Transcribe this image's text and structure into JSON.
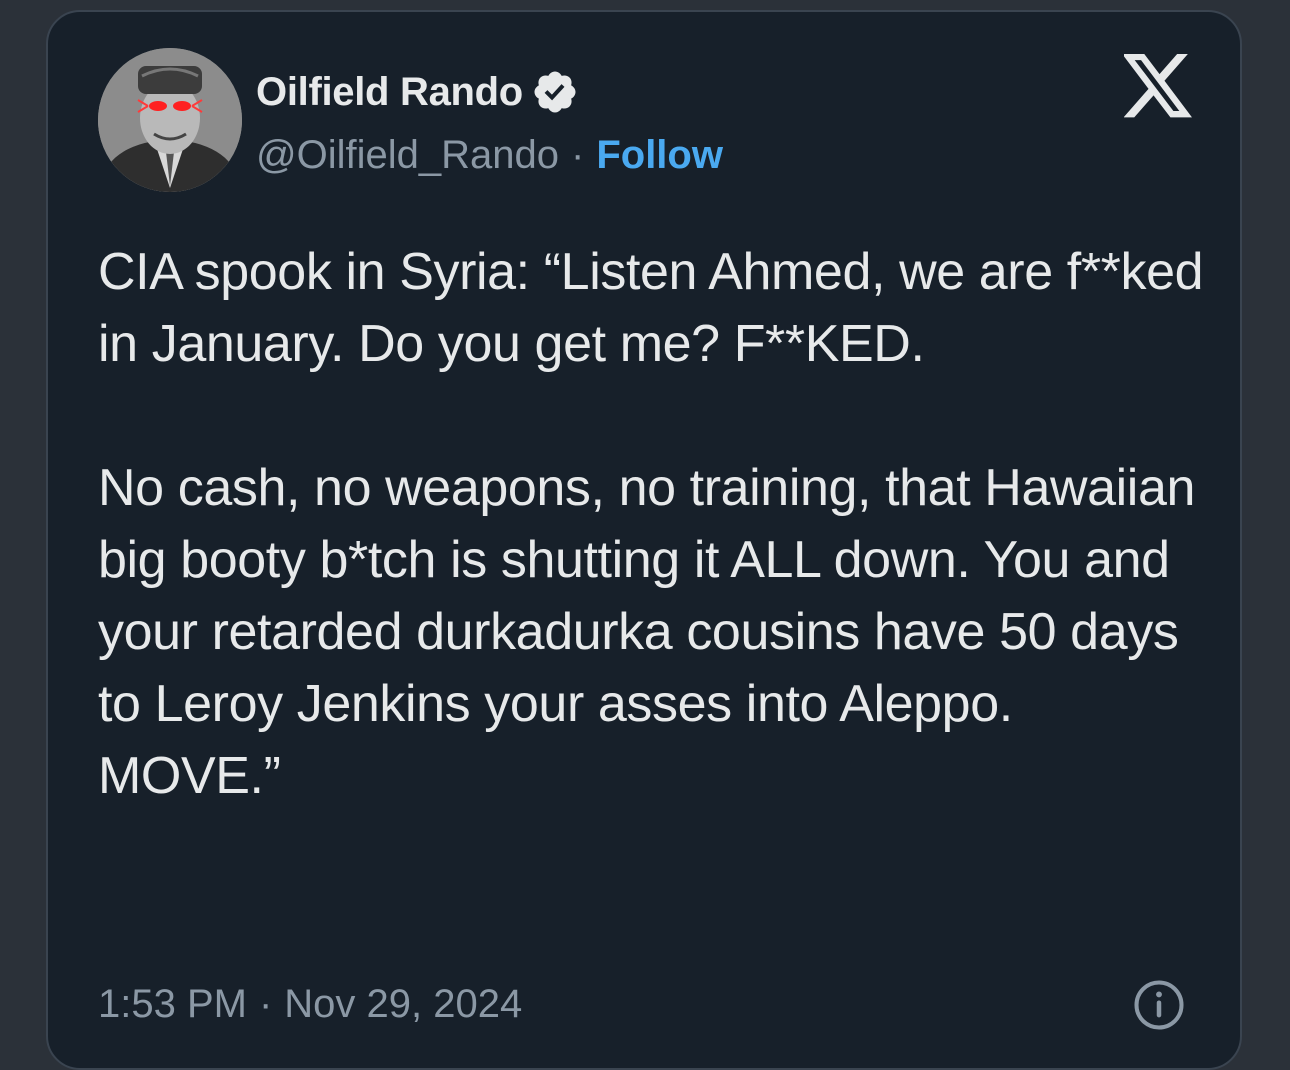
{
  "author": {
    "display_name": "Oilfield Rando",
    "handle": "@Oilfield_Rando",
    "separator": "·",
    "follow_label": "Follow",
    "verified": true,
    "avatar_icon": "avatar-laser-eyes-icon"
  },
  "tweet": {
    "paragraph_1": "CIA spook in Syria: “Listen Ahmed, we are f**ked in January. Do you get me? F**KED.",
    "paragraph_2": "No cash, no weapons, no training, that Hawaiian big booty b*tch is shutting it ALL down. You and your retarded durkadurka cousins have 50 days to Leroy Jenkins your asses into Aleppo. MOVE.”"
  },
  "meta": {
    "time": "1:53 PM",
    "separator": "·",
    "date": "Nov 29, 2024",
    "info_icon": "info-icon"
  },
  "brand": {
    "logo_icon": "x-logo-icon"
  },
  "colors": {
    "background": "#17202a",
    "text": "#e7e9ea",
    "muted": "#8b98a5",
    "link": "#4aa9f0",
    "verified_badge": "#e7e9ea"
  }
}
